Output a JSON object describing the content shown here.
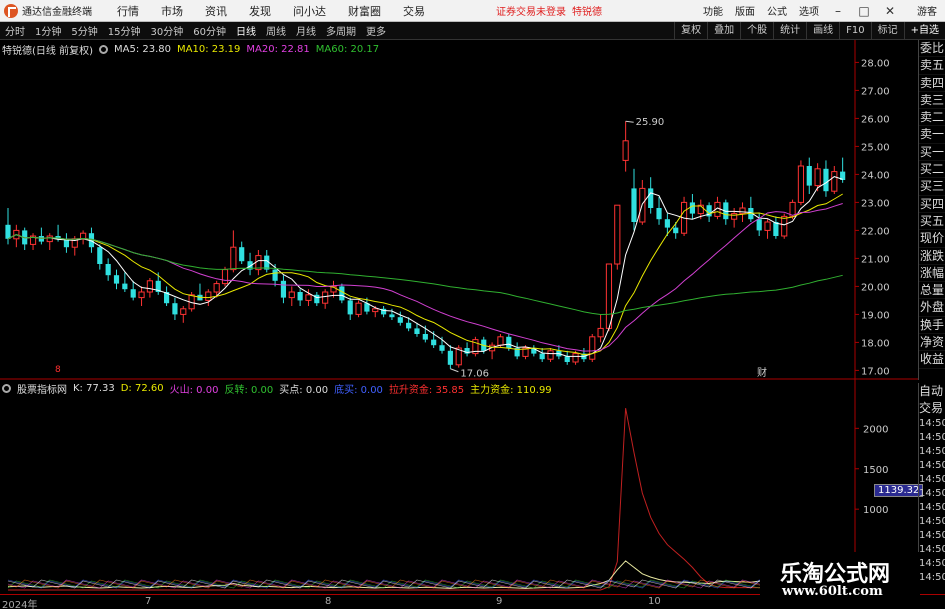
{
  "window": {
    "app_title": "通达信金融终端",
    "menu": [
      "行情",
      "市场",
      "资讯",
      "发现",
      "问小达",
      "财富圈",
      "交易"
    ],
    "login_status": "证券交易未登录",
    "user_name": "特锐德",
    "right_menu": [
      "功能",
      "版面",
      "公式",
      "选项"
    ],
    "guest": "游客"
  },
  "toolbar": {
    "periods": [
      "分时",
      "1分钟",
      "5分钟",
      "15分钟",
      "30分钟",
      "60分钟",
      "日线",
      "周线",
      "月线",
      "多周期",
      "更多"
    ],
    "active_period": "日线",
    "buttons": [
      "复权",
      "叠加",
      "个股",
      "统计",
      "画线",
      "F10",
      "标记",
      "+自选"
    ]
  },
  "main_info": {
    "stock": "特锐德(日线 前复权)",
    "ma5": "MA5: 23.80",
    "ma10": "MA10: 23.19",
    "ma20": "MA20: 22.81",
    "ma60": "MA60: 20.17",
    "high_label": "25.90",
    "low_label": "17.06",
    "marker_left": "8",
    "marker_cai": "财"
  },
  "indicator_info": {
    "name": "股票指标网",
    "k": "K: 77.33",
    "d": "D: 72.60",
    "huoshan": "火山: 0.00",
    "fanzhuan": "反转: 0.00",
    "maidian": "买点: 0.00",
    "xiongzhu": "底买: 0.00",
    "lasheng": "拉升资金: 35.85",
    "zhuli": "主力资金: 110.99",
    "value_tag": "1139.32"
  },
  "side_panel": [
    "委比",
    "卖五",
    "卖四",
    "卖三",
    "卖二",
    "卖一",
    "买一",
    "买二",
    "买三",
    "买四",
    "买五",
    "现价",
    "涨跌",
    "涨幅",
    "总量",
    "外盘",
    "换手",
    "净资",
    "收益"
  ],
  "side_panel2": [
    "自动",
    "交易"
  ],
  "side_times": [
    "14:50",
    "14:50",
    "14:50",
    "14:50",
    "14:50",
    "14:50",
    "14:50",
    "14:50",
    "14:50",
    "14:50",
    "14:50",
    "14:50"
  ],
  "watermark": {
    "main": "乐淘公式网",
    "url": "www.60lt.com"
  },
  "colors": {
    "up": "#ff3333",
    "down": "#30e0e0",
    "ma5": "#ffffff",
    "ma10": "#e8e800",
    "ma20": "#d040d0",
    "ma60": "#30b030"
  },
  "chart_data": [
    {
      "type": "candlestick",
      "title": "特锐德(日线 前复权)",
      "ylim": [
        16.8,
        28.3
      ],
      "y_ticks": [
        17.0,
        18.0,
        19.0,
        20.0,
        21.0,
        22.0,
        23.0,
        24.0,
        25.0,
        26.0,
        27.0,
        28.0
      ],
      "x_labels": [
        "2024年",
        "7",
        "8",
        "9",
        "10"
      ],
      "series": [
        {
          "name": "K",
          "ohlc": [
            [
              22.2,
              22.8,
              21.5,
              21.7
            ],
            [
              21.7,
              22.2,
              21.4,
              22.0
            ],
            [
              22.0,
              22.1,
              21.3,
              21.5
            ],
            [
              21.5,
              21.9,
              21.3,
              21.8
            ],
            [
              21.8,
              22.1,
              21.5,
              21.6
            ],
            [
              21.6,
              21.9,
              21.3,
              21.8
            ],
            [
              21.8,
              22.2,
              21.6,
              21.7
            ],
            [
              21.7,
              21.9,
              21.2,
              21.4
            ],
            [
              21.4,
              21.8,
              21.1,
              21.7
            ],
            [
              21.7,
              22.0,
              21.5,
              21.9
            ],
            [
              21.9,
              22.1,
              21.2,
              21.4
            ],
            [
              21.4,
              21.5,
              20.6,
              20.8
            ],
            [
              20.8,
              21.0,
              20.2,
              20.4
            ],
            [
              20.4,
              20.6,
              19.9,
              20.1
            ],
            [
              20.1,
              20.5,
              19.8,
              19.9
            ],
            [
              19.9,
              20.2,
              19.5,
              19.6
            ],
            [
              19.6,
              20.0,
              19.3,
              19.8
            ],
            [
              19.8,
              20.3,
              19.6,
              20.2
            ],
            [
              20.2,
              20.5,
              19.7,
              19.8
            ],
            [
              19.8,
              20.0,
              19.3,
              19.4
            ],
            [
              19.4,
              19.6,
              18.8,
              19.0
            ],
            [
              19.0,
              19.3,
              18.7,
              19.2
            ],
            [
              19.2,
              19.8,
              19.1,
              19.7
            ],
            [
              19.7,
              20.1,
              19.5,
              19.5
            ],
            [
              19.5,
              19.9,
              19.3,
              19.8
            ],
            [
              19.8,
              20.2,
              19.6,
              20.1
            ],
            [
              20.1,
              20.7,
              20.0,
              20.6
            ],
            [
              20.6,
              22.0,
              20.5,
              21.4
            ],
            [
              21.4,
              21.6,
              20.8,
              20.9
            ],
            [
              20.9,
              21.2,
              20.4,
              20.6
            ],
            [
              20.6,
              21.3,
              20.4,
              21.1
            ],
            [
              21.1,
              21.3,
              20.5,
              20.6
            ],
            [
              20.6,
              20.8,
              20.0,
              20.2
            ],
            [
              20.2,
              20.4,
              19.4,
              19.6
            ],
            [
              19.6,
              20.0,
              19.3,
              19.8
            ],
            [
              19.8,
              19.9,
              19.3,
              19.5
            ],
            [
              19.5,
              19.9,
              19.3,
              19.7
            ],
            [
              19.7,
              19.8,
              19.3,
              19.4
            ],
            [
              19.4,
              19.9,
              19.2,
              19.8
            ],
            [
              19.8,
              20.2,
              19.6,
              20.0
            ],
            [
              20.0,
              20.1,
              19.4,
              19.5
            ],
            [
              19.5,
              19.6,
              18.8,
              19.0
            ],
            [
              19.0,
              19.5,
              18.9,
              19.4
            ],
            [
              19.4,
              19.6,
              19.0,
              19.1
            ],
            [
              19.1,
              19.3,
              18.9,
              19.2
            ],
            [
              19.2,
              19.3,
              18.9,
              19.0
            ],
            [
              19.0,
              19.2,
              18.8,
              18.9
            ],
            [
              18.9,
              19.1,
              18.6,
              18.7
            ],
            [
              18.7,
              18.9,
              18.4,
              18.5
            ],
            [
              18.5,
              18.7,
              18.2,
              18.3
            ],
            [
              18.3,
              18.6,
              18.0,
              18.1
            ],
            [
              18.1,
              18.4,
              17.8,
              17.9
            ],
            [
              17.9,
              18.2,
              17.6,
              17.7
            ],
            [
              17.7,
              17.9,
              17.06,
              17.2
            ],
            [
              17.2,
              17.9,
              17.1,
              17.8
            ],
            [
              17.8,
              18.0,
              17.5,
              17.6
            ],
            [
              17.6,
              18.2,
              17.5,
              18.1
            ],
            [
              18.1,
              18.2,
              17.6,
              17.7
            ],
            [
              17.7,
              18.0,
              17.4,
              17.9
            ],
            [
              17.9,
              18.3,
              17.8,
              18.2
            ],
            [
              18.2,
              18.3,
              17.7,
              17.8
            ],
            [
              17.8,
              18.0,
              17.4,
              17.5
            ],
            [
              17.5,
              17.9,
              17.4,
              17.8
            ],
            [
              17.8,
              17.9,
              17.5,
              17.6
            ],
            [
              17.6,
              17.8,
              17.3,
              17.4
            ],
            [
              17.4,
              17.8,
              17.3,
              17.7
            ],
            [
              17.7,
              17.9,
              17.4,
              17.5
            ],
            [
              17.5,
              17.7,
              17.2,
              17.3
            ],
            [
              17.3,
              17.7,
              17.2,
              17.6
            ],
            [
              17.6,
              17.8,
              17.3,
              17.4
            ],
            [
              17.4,
              18.3,
              17.3,
              18.2
            ],
            [
              18.2,
              19.0,
              18.0,
              18.5
            ],
            [
              18.5,
              20.8,
              18.4,
              20.8
            ],
            [
              20.8,
              22.9,
              20.6,
              22.9
            ],
            [
              24.5,
              25.9,
              24.1,
              25.2
            ],
            [
              23.5,
              24.2,
              22.0,
              22.3
            ],
            [
              22.3,
              23.8,
              22.2,
              23.5
            ],
            [
              23.5,
              23.9,
              22.6,
              22.8
            ],
            [
              22.8,
              23.2,
              22.2,
              22.4
            ],
            [
              22.4,
              22.6,
              21.8,
              22.1
            ],
            [
              22.1,
              22.3,
              21.7,
              21.9
            ],
            [
              21.9,
              23.2,
              21.8,
              23.0
            ],
            [
              23.0,
              23.3,
              22.4,
              22.6
            ],
            [
              22.6,
              23.1,
              22.4,
              22.9
            ],
            [
              22.9,
              23.0,
              22.3,
              22.5
            ],
            [
              22.5,
              23.2,
              22.4,
              23.0
            ],
            [
              23.0,
              23.1,
              22.2,
              22.4
            ],
            [
              22.4,
              22.8,
              22.1,
              22.6
            ],
            [
              22.6,
              23.0,
              22.3,
              22.8
            ],
            [
              22.8,
              23.2,
              22.3,
              22.4
            ],
            [
              22.4,
              22.6,
              21.8,
              22.0
            ],
            [
              22.0,
              22.4,
              21.7,
              22.3
            ],
            [
              22.3,
              22.5,
              21.7,
              21.8
            ],
            [
              21.8,
              22.6,
              21.7,
              22.5
            ],
            [
              22.5,
              23.1,
              22.4,
              23.0
            ],
            [
              23.0,
              24.5,
              22.9,
              24.3
            ],
            [
              24.3,
              24.6,
              23.3,
              23.6
            ],
            [
              23.6,
              24.4,
              23.4,
              24.2
            ],
            [
              24.2,
              24.5,
              23.2,
              23.4
            ],
            [
              23.4,
              24.3,
              23.3,
              24.1
            ],
            [
              24.1,
              24.6,
              23.7,
              23.8
            ]
          ]
        }
      ]
    },
    {
      "type": "line",
      "title": "股票指标网",
      "ylim": [
        0,
        2400
      ],
      "y_ticks": [
        1000,
        1500,
        2000
      ],
      "series": [
        {
          "name": "拉升资金",
          "values": [
            0,
            0,
            0,
            0,
            0,
            0,
            0,
            0,
            0,
            0,
            0,
            0,
            0,
            0,
            0,
            0,
            0,
            0,
            0,
            0,
            0,
            0,
            0,
            0,
            0,
            0,
            0,
            0,
            0,
            0,
            0,
            0,
            0,
            0,
            0,
            0,
            0,
            0,
            0,
            0,
            0,
            0,
            0,
            0,
            0,
            0,
            0,
            0,
            0,
            0,
            0,
            0,
            0,
            0,
            0,
            0,
            0,
            0,
            0,
            0,
            0,
            0,
            0,
            0,
            0,
            0,
            0,
            0,
            0,
            0,
            0,
            0,
            40,
            350,
            2250,
            1700,
            1200,
            900,
            700,
            560,
            470,
            380,
            280,
            160,
            70,
            40,
            30,
            30,
            30,
            30,
            30,
            30,
            30,
            30,
            30,
            35,
            35,
            35,
            35,
            35,
            36
          ]
        },
        {
          "name": "主力资金",
          "values": [
            40,
            45,
            50,
            40,
            35,
            40,
            45,
            50,
            40,
            35,
            30,
            25,
            30,
            40,
            35,
            30,
            25,
            30,
            40,
            45,
            40,
            35,
            30,
            40,
            50,
            55,
            60,
            80,
            60,
            50,
            40,
            45,
            40,
            35,
            30,
            40,
            45,
            40,
            35,
            30,
            35,
            40,
            35,
            30,
            25,
            30,
            35,
            30,
            25,
            30,
            35,
            30,
            25,
            20,
            30,
            35,
            30,
            25,
            30,
            35,
            30,
            25,
            20,
            25,
            30,
            35,
            30,
            25,
            30,
            35,
            60,
            80,
            120,
            250,
            360,
            280,
            200,
            160,
            130,
            110,
            100,
            95,
            90,
            85,
            80,
            100,
            110,
            105,
            100,
            95,
            110,
            120,
            115,
            110,
            105,
            110,
            110,
            111,
            110,
            110,
            111
          ]
        }
      ]
    }
  ]
}
